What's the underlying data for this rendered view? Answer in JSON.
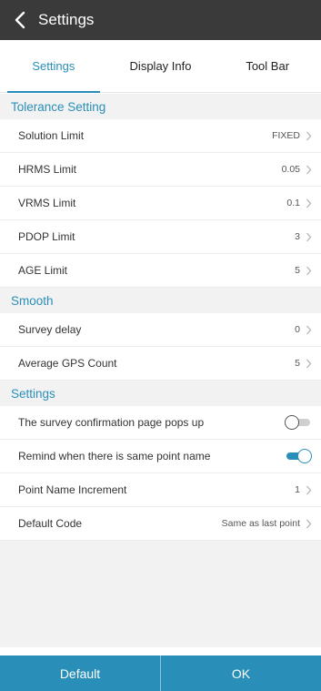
{
  "header": {
    "title": "Settings",
    "back_icon": "chevron-left-icon"
  },
  "tabs": [
    {
      "label": "Settings",
      "active": true
    },
    {
      "label": "Display Info",
      "active": false
    },
    {
      "label": "Tool Bar",
      "active": false
    }
  ],
  "tolerance": {
    "title": "Tolerance Setting",
    "rows": [
      {
        "label": "Solution Limit",
        "value": "FIXED"
      },
      {
        "label": "HRMS Limit",
        "value": "0.05"
      },
      {
        "label": "VRMS Limit",
        "value": "0.1"
      },
      {
        "label": "PDOP Limit",
        "value": "3"
      },
      {
        "label": "AGE Limit",
        "value": "5"
      }
    ]
  },
  "smooth": {
    "title": "Smooth",
    "rows": [
      {
        "label": "Survey delay",
        "value": "0"
      },
      {
        "label": "Average GPS Count",
        "value": "5"
      }
    ]
  },
  "settings": {
    "title": "Settings",
    "toggles": [
      {
        "label": "The survey confirmation page pops up",
        "on": false
      },
      {
        "label": "Remind when there is same point name",
        "on": true
      }
    ],
    "rows": [
      {
        "label": "Point Name Increment",
        "value": "1"
      },
      {
        "label": "Default Code",
        "value": "Same as last point"
      }
    ]
  },
  "footer": {
    "default_label": "Default",
    "ok_label": "OK"
  },
  "colors": {
    "accent": "#2a8fb8",
    "titlebar": "#3a3a3a",
    "background": "#f2f2f2"
  }
}
